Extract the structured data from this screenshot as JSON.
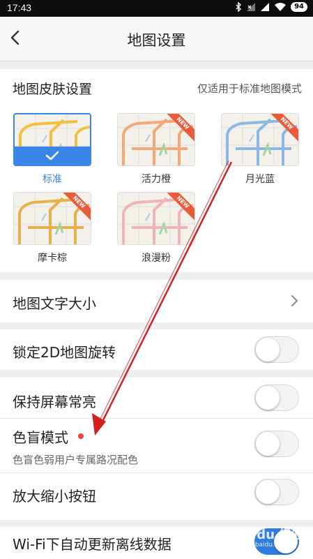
{
  "status_bar": {
    "time": "17:43",
    "battery": "94",
    "icons": [
      "bluetooth-icon",
      "signal-x-icon",
      "signal-bars-icon",
      "wifi-icon",
      "battery-icon"
    ]
  },
  "nav": {
    "title": "地图设置",
    "back_icon": "back-chevron-icon"
  },
  "skin": {
    "heading": "地图皮肤设置",
    "note": "仅适用于标准地图模式",
    "new_label": "NEW",
    "options": [
      {
        "label": "标准",
        "selected": true,
        "is_new": false,
        "color": "#f0c040"
      },
      {
        "label": "活力橙",
        "selected": false,
        "is_new": true,
        "color": "#f2a97a"
      },
      {
        "label": "月光蓝",
        "selected": false,
        "is_new": true,
        "color": "#8cb8e6"
      },
      {
        "label": "摩卡棕",
        "selected": false,
        "is_new": true,
        "color": "#e8b04a"
      },
      {
        "label": "浪漫粉",
        "selected": false,
        "is_new": true,
        "color": "#f0b3b8"
      }
    ]
  },
  "settings": {
    "text_size": {
      "label": "地图文字大小"
    },
    "lock_rotation": {
      "label": "锁定2D地图旋转",
      "on": false
    },
    "keep_screen_on": {
      "label": "保持屏幕常亮",
      "on": false
    },
    "color_blind": {
      "label": "色盲模式",
      "sub": "色盲色弱用户专属路况配色",
      "on": false,
      "has_dot": true
    },
    "zoom_buttons": {
      "label": "放大缩小按钮",
      "on": false
    },
    "wifi_update": {
      "label": "Wi-Fi下自动更新离线数据",
      "on": true
    }
  },
  "colors": {
    "accent": "#3a86e8",
    "toggle_on": "#2f7de1",
    "badge_new": "#e95b3a",
    "red_dot": "#f04040",
    "annotation_arrow": "#d42020"
  },
  "watermark": {
    "brand": "Bai du 经验",
    "url": "jingyan.baidu.com"
  }
}
